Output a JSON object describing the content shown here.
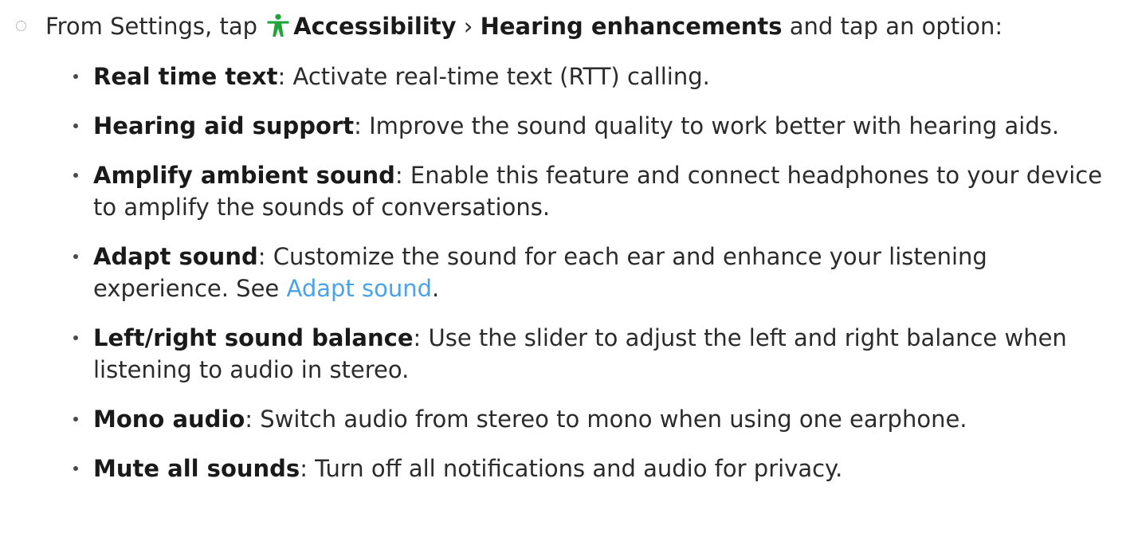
{
  "intro": {
    "prefix": "From Settings, tap ",
    "accessibility": "Accessibility",
    "separator": " › ",
    "hearing": "Hearing enhancements",
    "suffix": " and tap an option:",
    "icon": "accessibility-person-icon",
    "icon_color": "#21a53a"
  },
  "options": [
    {
      "term": "Real time text",
      "description": ": Activate real-time text (RTT) calling."
    },
    {
      "term": "Hearing aid support",
      "description": ": Improve the sound quality to work better with hearing aids."
    },
    {
      "term": "Amplify ambient sound",
      "description": ": Enable this feature and connect headphones to your device to amplify the sounds of conversations."
    },
    {
      "term": "Adapt sound",
      "description": ": Customize the sound for each ear and enhance your listening experience. See ",
      "link": "Adapt sound",
      "after": "."
    },
    {
      "term": "Left/right sound balance",
      "description": ": Use the slider to adjust the left and right balance when listening to audio in stereo."
    },
    {
      "term": "Mono audio",
      "description": ": Switch audio from stereo to mono when using one earphone."
    },
    {
      "term": "Mute all sounds",
      "description": ": Turn off all notifications and audio for privacy."
    }
  ],
  "colors": {
    "link": "#4aa3e8",
    "text": "#2b2b2b"
  }
}
